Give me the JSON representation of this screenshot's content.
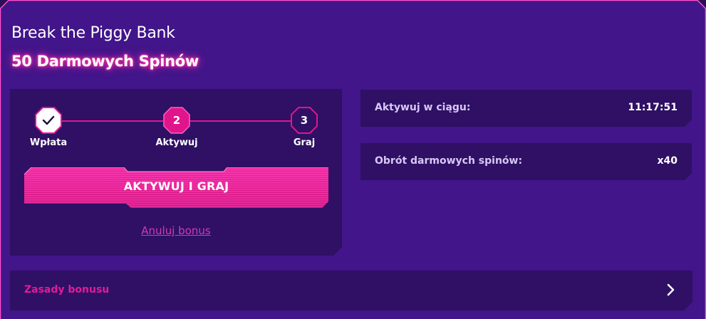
{
  "bonus": {
    "title": "Break the Piggy Bank",
    "subtitle": "50 Darmowych Spinów"
  },
  "steps": [
    {
      "number": "",
      "label": "Wpłata",
      "state": "completed",
      "icon": "check-icon"
    },
    {
      "number": "2",
      "label": "Aktywuj",
      "state": "active"
    },
    {
      "number": "3",
      "label": "Graj",
      "state": "upcoming"
    }
  ],
  "actions": {
    "activate_label": "AKTYWUJ I GRAJ",
    "cancel_label": "Anuluj bonus"
  },
  "info": {
    "activate_within_label": "Aktywuj w ciągu:",
    "activate_within_value": "11:17:51",
    "wagering_label": "Obrót darmowych spinów:",
    "wagering_value": "x40"
  },
  "rules": {
    "label": "Zasady bonusu",
    "icon": "chevron-right-icon"
  },
  "colors": {
    "background": "#42158a",
    "panel": "#2f1064",
    "accent": "#e0158c",
    "link": "#d13bb0",
    "border_glow": "#ff4fc8"
  }
}
